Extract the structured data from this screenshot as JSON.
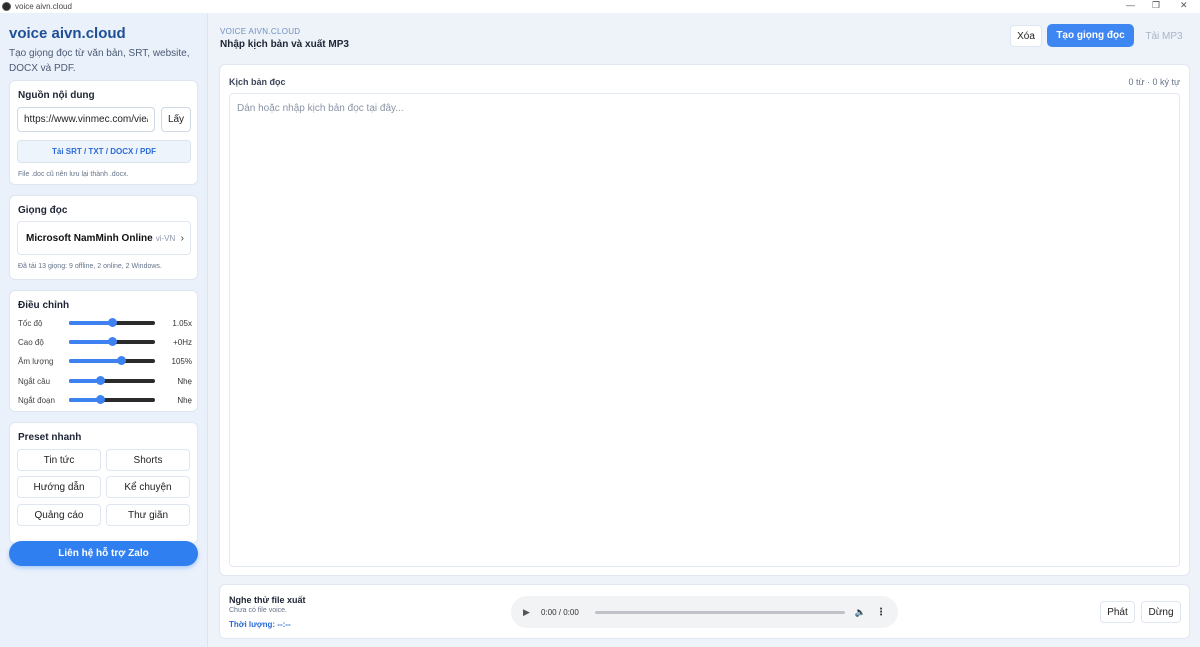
{
  "window": {
    "title": "voice aivn.cloud",
    "minimize_glyph": "—",
    "restore_glyph": "❐",
    "close_glyph": "✕"
  },
  "sidebar": {
    "brand": "voice aivn.cloud",
    "tagline": "Tạo giọng đọc từ văn bản, SRT, website, DOCX và PDF.",
    "source": {
      "title": "Nguồn nội dung",
      "url_value": "https://www.vinmec.com/vie/",
      "fetch_label": "Lấy",
      "upload_label": "Tải SRT / TXT / DOCX / PDF",
      "hint": "File .doc cũ nên lưu lại thành .docx."
    },
    "voice": {
      "title": "Giọng đọc",
      "selected_name": "Microsoft NamMinh Online",
      "selected_lang": "vi-VN",
      "chevron": "›",
      "hint": "Đã tải 13 giọng: 9 offline, 2 online, 2 Windows."
    },
    "adjust": {
      "title": "Điều chỉnh",
      "sliders": [
        {
          "label": "Tốc độ",
          "value": "1.05x",
          "level": 0.5
        },
        {
          "label": "Cao độ",
          "value": "+0Hz",
          "level": 0.5
        },
        {
          "label": "Âm lượng",
          "value": "105%",
          "level": 0.6
        },
        {
          "label": "Ngắt câu",
          "value": "Nhẹ",
          "level": 0.36
        },
        {
          "label": "Ngắt đoạn",
          "value": "Nhẹ",
          "level": 0.36
        }
      ]
    },
    "presets": {
      "title": "Preset nhanh",
      "items": [
        "Tin tức",
        "Shorts",
        "Hướng dẫn",
        "Kể chuyện",
        "Quảng cáo",
        "Thư giãn"
      ]
    },
    "zalo_label": "Liên hệ hỗ trợ Zalo"
  },
  "main": {
    "eyebrow": "VOICE AIVN.CLOUD",
    "title": "Nhập kịch bản và xuất MP3",
    "actions": {
      "clear": "Xóa",
      "generate": "Tạo giọng đọc",
      "download": "Tải MP3"
    },
    "script": {
      "label": "Kịch bản đọc",
      "count": "0 từ · 0 ký tự",
      "placeholder": "Dán hoặc nhập kịch bản đọc tại đây..."
    },
    "player": {
      "title": "Nghe thử file xuất",
      "subtitle": "Chưa có file voice.",
      "duration_label": "Thời lượng:",
      "duration_value": "--:--",
      "time": "0:00 / 0:00",
      "play_glyph": "▶",
      "volume_glyph": "🔈",
      "more_glyph": "⋮",
      "play_label": "Phát",
      "stop_label": "Dừng"
    }
  }
}
